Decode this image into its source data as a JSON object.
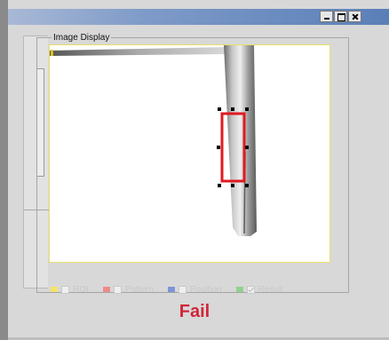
{
  "window": {
    "controls": {
      "minimize_icon": "minimize-icon",
      "maximize_icon": "maximize-icon",
      "close_icon": "close-icon"
    }
  },
  "image_display": {
    "label": "Image Display",
    "frame_color": "#e8e06a",
    "roi_color": "#e01a22"
  },
  "legend": {
    "items": [
      {
        "label": "ROI",
        "color": "#f5e36a",
        "checked": false
      },
      {
        "label": "Pattern",
        "color": "#f08a8a",
        "checked": false
      },
      {
        "label": "Position",
        "color": "#7f94d8",
        "checked": false
      },
      {
        "label": "Result",
        "color": "#8fd28f",
        "checked": true
      }
    ]
  },
  "status": {
    "text": "Fail",
    "color": "#d0273a"
  }
}
